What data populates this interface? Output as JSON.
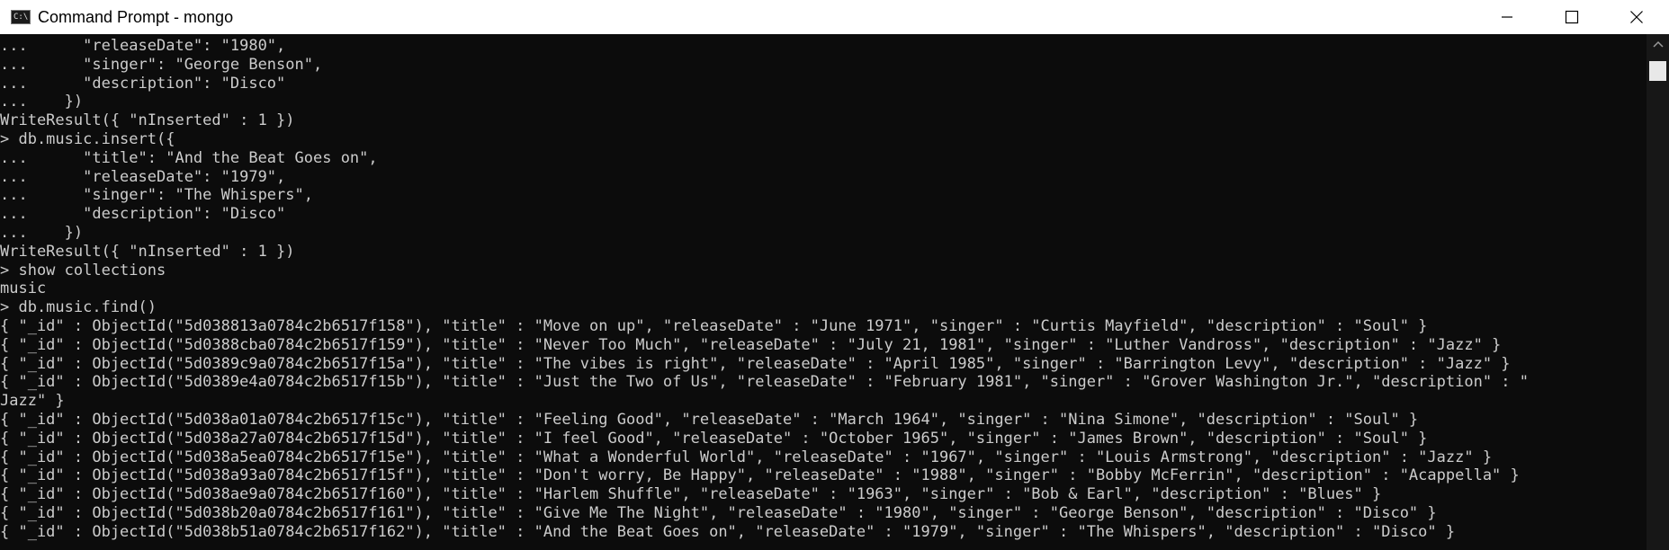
{
  "window": {
    "title": "Command Prompt - mongo",
    "app_icon_text": "C:\\",
    "controls": {
      "minimize_icon": "minimize-icon",
      "maximize_icon": "maximize-icon",
      "close_icon": "close-icon"
    }
  },
  "console": {
    "lines": [
      "...      \"releaseDate\": \"1980\",",
      "...      \"singer\": \"George Benson\",",
      "...      \"description\": \"Disco\"",
      "...    })",
      "WriteResult({ \"nInserted\" : 1 })",
      "> db.music.insert({",
      "...      \"title\": \"And the Beat Goes on\",",
      "...      \"releaseDate\": \"1979\",",
      "...      \"singer\": \"The Whispers\",",
      "...      \"description\": \"Disco\"",
      "...    })",
      "WriteResult({ \"nInserted\" : 1 })",
      "> show collections",
      "music",
      "> db.music.find()",
      "{ \"_id\" : ObjectId(\"5d038813a0784c2b6517f158\"), \"title\" : \"Move on up\", \"releaseDate\" : \"June 1971\", \"singer\" : \"Curtis Mayfield\", \"description\" : \"Soul\" }",
      "{ \"_id\" : ObjectId(\"5d0388cba0784c2b6517f159\"), \"title\" : \"Never Too Much\", \"releaseDate\" : \"July 21, 1981\", \"singer\" : \"Luther Vandross\", \"description\" : \"Jazz\" }",
      "{ \"_id\" : ObjectId(\"5d0389c9a0784c2b6517f15a\"), \"title\" : \"The vibes is right\", \"releaseDate\" : \"April 1985\", \"singer\" : \"Barrington Levy\", \"description\" : \"Jazz\" }",
      "{ \"_id\" : ObjectId(\"5d0389e4a0784c2b6517f15b\"), \"title\" : \"Just the Two of Us\", \"releaseDate\" : \"February 1981\", \"singer\" : \"Grover Washington Jr.\", \"description\" : \"",
      "Jazz\" }",
      "{ \"_id\" : ObjectId(\"5d038a01a0784c2b6517f15c\"), \"title\" : \"Feeling Good\", \"releaseDate\" : \"March 1964\", \"singer\" : \"Nina Simone\", \"description\" : \"Soul\" }",
      "{ \"_id\" : ObjectId(\"5d038a27a0784c2b6517f15d\"), \"title\" : \"I feel Good\", \"releaseDate\" : \"October 1965\", \"singer\" : \"James Brown\", \"description\" : \"Soul\" }",
      "{ \"_id\" : ObjectId(\"5d038a5ea0784c2b6517f15e\"), \"title\" : \"What a Wonderful World\", \"releaseDate\" : \"1967\", \"singer\" : \"Louis Armstrong\", \"description\" : \"Jazz\" }",
      "{ \"_id\" : ObjectId(\"5d038a93a0784c2b6517f15f\"), \"title\" : \"Don't worry, Be Happy\", \"releaseDate\" : \"1988\", \"singer\" : \"Bobby McFerrin\", \"description\" : \"Acappella\" }",
      "{ \"_id\" : ObjectId(\"5d038ae9a0784c2b6517f160\"), \"title\" : \"Harlem Shuffle\", \"releaseDate\" : \"1963\", \"singer\" : \"Bob & Earl\", \"description\" : \"Blues\" }",
      "{ \"_id\" : ObjectId(\"5d038b20a0784c2b6517f161\"), \"title\" : \"Give Me The Night\", \"releaseDate\" : \"1980\", \"singer\" : \"George Benson\", \"description\" : \"Disco\" }",
      "{ \"_id\" : ObjectId(\"5d038b51a0784c2b6517f162\"), \"title\" : \"And the Beat Goes on\", \"releaseDate\" : \"1979\", \"singer\" : \"The Whispers\", \"description\" : \"Disco\" }"
    ]
  },
  "colors": {
    "console_background": "#0c0c0c",
    "console_text": "#cccccc",
    "titlebar_background": "#ffffff"
  }
}
